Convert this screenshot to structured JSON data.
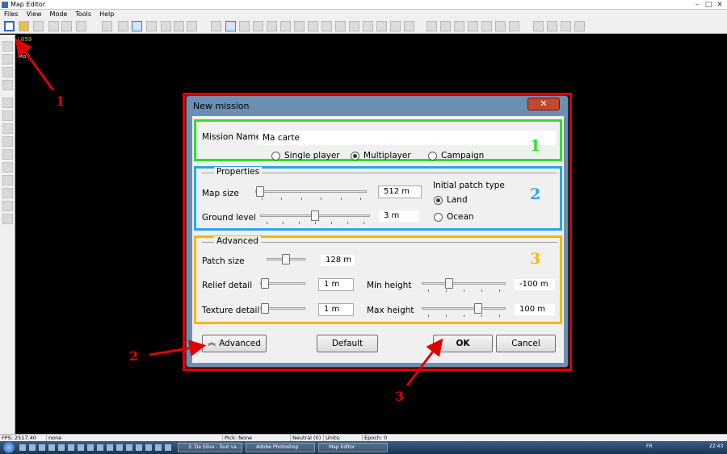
{
  "window": {
    "title": "Map Editor"
  },
  "menu": [
    "Files",
    "View",
    "Mode",
    "Tools",
    "Help"
  ],
  "overlay": {
    "top": "L059",
    "bottom": "Mo t"
  },
  "dialog": {
    "title": "New mission",
    "close_label": "✕",
    "mission_name_label": "Mission Name",
    "mission_name_value": "Ma carte",
    "mode_options": [
      {
        "label": "Single player",
        "checked": false
      },
      {
        "label": "Multiplayer",
        "checked": true
      },
      {
        "label": "Campaign",
        "checked": false
      }
    ],
    "properties": {
      "title": "Properties",
      "map_size_label": "Map size",
      "map_size_value": "512 m",
      "map_size_level": 0.0,
      "ground_level_label": "Ground level",
      "ground_level_value": "3 m",
      "ground_level_level": 0.5,
      "patch_type_title": "Initial patch type",
      "patch_options": [
        {
          "label": "Land",
          "checked": true
        },
        {
          "label": "Ocean",
          "checked": false
        }
      ]
    },
    "advanced": {
      "title": "Advanced",
      "patch_size_label": "Patch size",
      "patch_size_value": "128 m",
      "patch_size_level": 0.5,
      "relief_detail_label": "Relief detail",
      "relief_detail_value": "1 m",
      "relief_detail_level": 0.0,
      "texture_detail_label": "Texture detail",
      "texture_detail_value": "1 m",
      "texture_detail_level": 0.0,
      "min_height_label": "Min height",
      "min_height_value": "-100 m",
      "min_height_level": 0.3,
      "max_height_label": "Max height",
      "max_height_value": "100 m",
      "max_height_level": 0.7
    },
    "buttons": {
      "advanced": "Advanced",
      "default": "Default",
      "ok": "OK",
      "cancel": "Cancel"
    }
  },
  "frame_numbers": {
    "one": "1",
    "two": "2",
    "three": "3",
    "colors": {
      "one": "#2ee02e",
      "two": "#29a6e8",
      "three": "#f5b800"
    }
  },
  "annotations": {
    "one": "1",
    "two": "2",
    "three": "3",
    "color": "#e00000"
  },
  "statusbar": {
    "fps": "FPS: 2517.40",
    "selection": "none",
    "pick": "Pick: None",
    "neutral": "Neutral (0)",
    "units": "Units:",
    "epoch": "Epoch: 0"
  },
  "taskbar": {
    "tasks": [
      "3. Da Silva - Tout va ...",
      "Adobe Photoshop",
      "Map Editor"
    ],
    "lang": "FR",
    "clock": "22:43"
  }
}
